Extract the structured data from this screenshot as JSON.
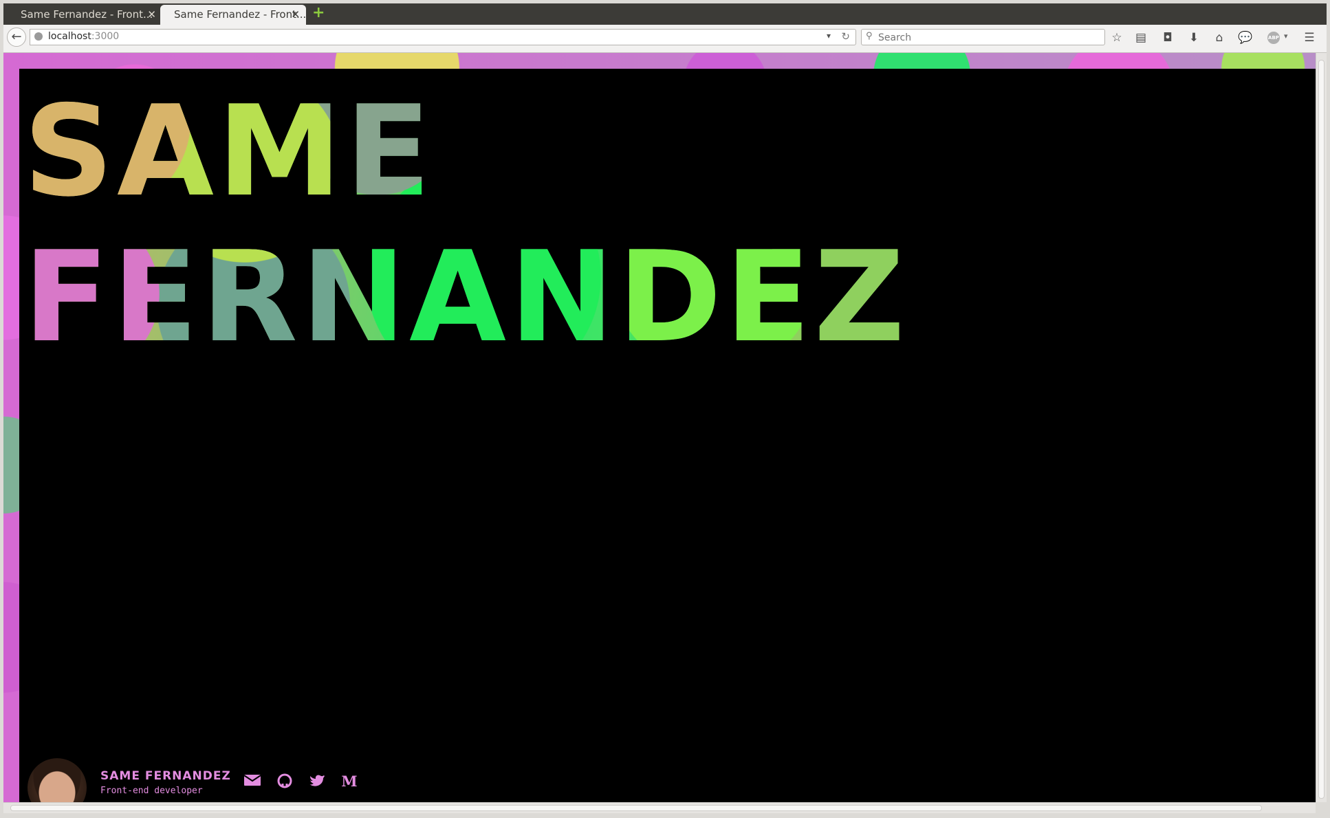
{
  "browser": {
    "tabs": [
      {
        "title": "Same Fernandez - Front...",
        "active": false
      },
      {
        "title": "Same Fernandez - Front...",
        "active": true
      }
    ],
    "new_tab_icon": "plus-icon",
    "url_host": "localhost",
    "url_port": ":3000",
    "search_placeholder": "Search",
    "toolbar_icons": [
      "star-icon",
      "reading-list-icon",
      "pocket-icon",
      "download-icon",
      "home-icon",
      "chat-icon",
      "adblock-icon",
      "menu-icon"
    ],
    "adblock_label": "ABP"
  },
  "page": {
    "hero_line1": "SAME",
    "hero_line2": "FERNANDEZ",
    "footer": {
      "name": "SAME FERNANDEZ",
      "role": "Front-end developer",
      "social": [
        "email-icon",
        "github-icon",
        "twitter-icon",
        "medium-icon"
      ],
      "medium_label": "M"
    },
    "colors": {
      "background": "#000000",
      "accent_pink": "#e38de0",
      "hero_green": "#22ec5a",
      "hero_gold": "#d8b46a"
    }
  }
}
